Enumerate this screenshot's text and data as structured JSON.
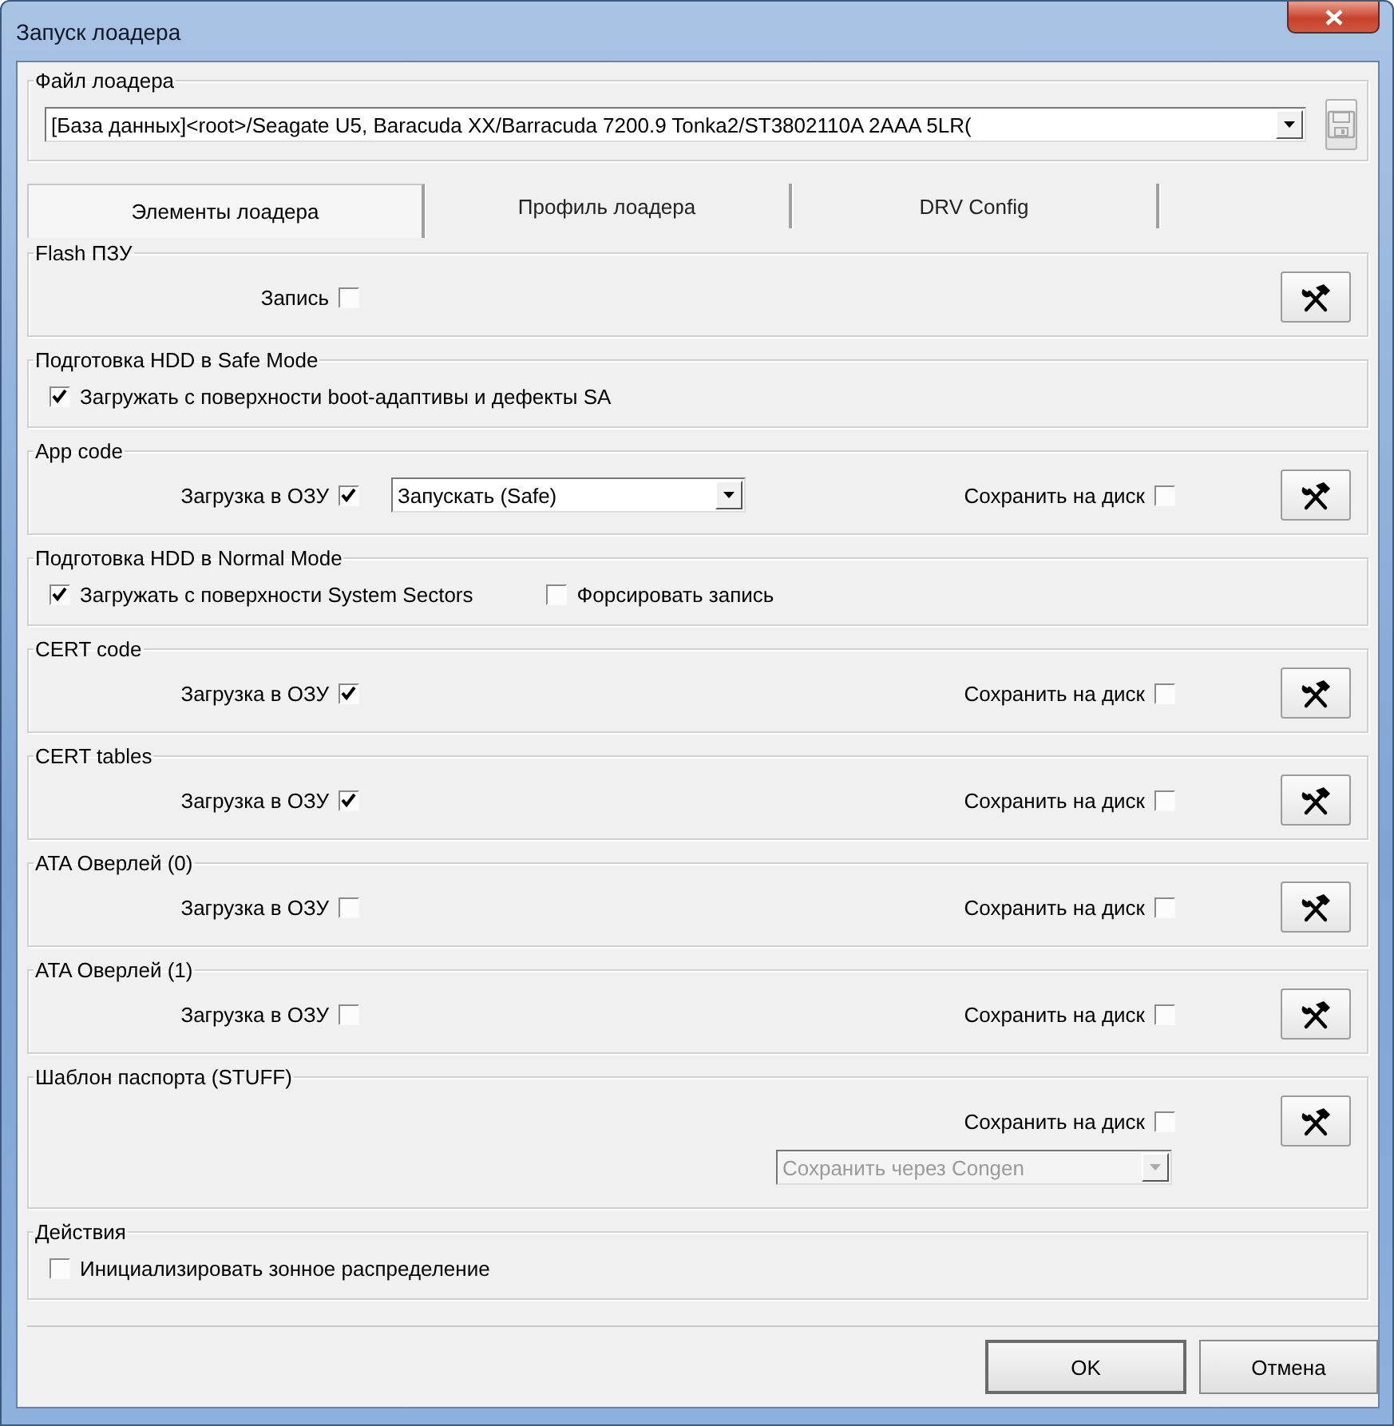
{
  "window": {
    "title": "Запуск лоадера"
  },
  "loader_file": {
    "label": "Файл лоадера",
    "value": "[База данных]<root>/Seagate U5, Baracuda XX/Barracuda 7200.9 Tonka2/ST3802110A 2AAA 5LR(",
    "save_button": {
      "disabled": true
    }
  },
  "tabs": [
    {
      "label": "Элементы лоадера",
      "selected": true
    },
    {
      "label": "Профиль лоадера",
      "selected": false
    },
    {
      "label": "DRV Config",
      "selected": false
    }
  ],
  "sections": [
    {
      "kind": "module",
      "title": "Flash ПЗУ",
      "load": {
        "label": "Запись",
        "checked": false
      }
    },
    {
      "kind": "options",
      "title": "Подготовка HDD в Safe Mode",
      "options": [
        {
          "label": "Загружать с поверхности boot-адаптивы и дефекты SA",
          "checked": true
        }
      ]
    },
    {
      "kind": "module",
      "title": "App code",
      "load": {
        "label": "Загрузка в ОЗУ",
        "checked": true
      },
      "mode": {
        "value": "Запускать (Safe)",
        "disabled": false
      },
      "save": {
        "label": "Сохранить на диск",
        "checked": false
      }
    },
    {
      "kind": "options",
      "title": "Подготовка HDD в Normal Mode",
      "options": [
        {
          "label": "Загружать с поверхности System Sectors",
          "checked": true
        },
        {
          "label": "Форсировать запись",
          "checked": false
        }
      ]
    },
    {
      "kind": "module",
      "title": "CERT code",
      "load": {
        "label": "Загрузка в ОЗУ",
        "checked": true
      },
      "save": {
        "label": "Сохранить на диск",
        "checked": false
      }
    },
    {
      "kind": "module",
      "title": "CERT tables",
      "load": {
        "label": "Загрузка в ОЗУ",
        "checked": true
      },
      "save": {
        "label": "Сохранить на диск",
        "checked": false
      }
    },
    {
      "kind": "module",
      "title": "ATA Оверлей (0)",
      "load": {
        "label": "Загрузка в ОЗУ",
        "checked": false
      },
      "save": {
        "label": "Сохранить на диск",
        "checked": false
      }
    },
    {
      "kind": "module",
      "title": "ATA Оверлей (1)",
      "load": {
        "label": "Загрузка в ОЗУ",
        "checked": false
      },
      "save": {
        "label": "Сохранить на диск",
        "checked": false
      }
    },
    {
      "kind": "module",
      "title": "Шаблон паспорта (STUFF)",
      "save": {
        "label": "Сохранить на диск",
        "checked": false
      },
      "save_mode": {
        "value": "Сохранить через Congen",
        "disabled": true
      }
    },
    {
      "kind": "options",
      "title": "Действия",
      "options": [
        {
          "label": "Инициализировать зонное распределение",
          "checked": false
        }
      ]
    }
  ],
  "buttons": [
    {
      "label": "OK"
    },
    {
      "label": "Отмена"
    }
  ]
}
